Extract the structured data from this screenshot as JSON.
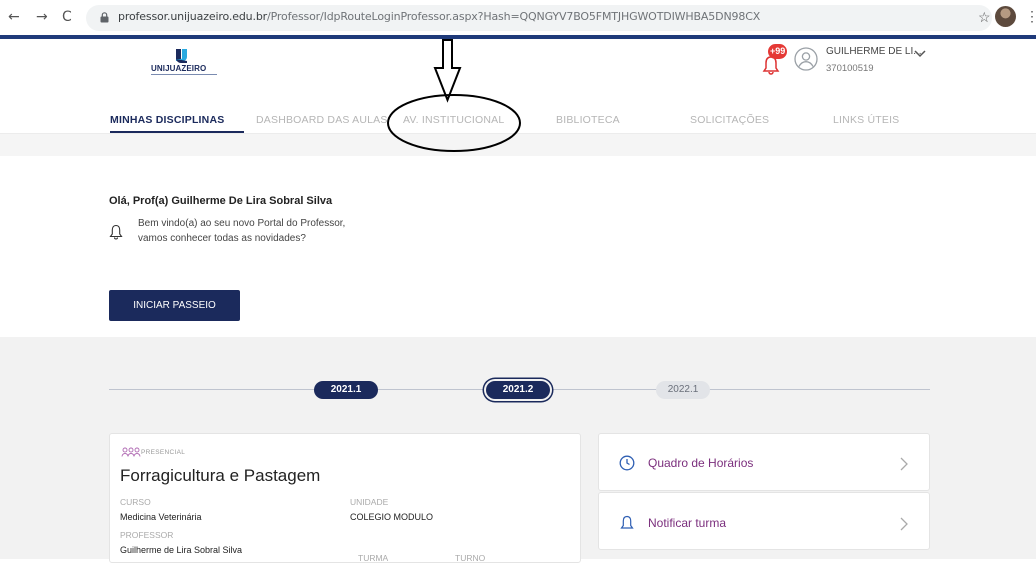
{
  "browser": {
    "back_glyph": "←",
    "forward_glyph": "→",
    "reload_glyph": "C",
    "url_host": "professor.unijuazeiro.edu.br",
    "url_path": "/Professor/IdpRouteLoginProfessor.aspx?Hash=QQNGYV7BO5FMTJHGWOTDIWHBA5DN98CX",
    "star_glyph": "☆",
    "menu_glyph": "⋮"
  },
  "header": {
    "logo_text": "UNIJUAZEIRO",
    "notification_count": "+99",
    "user_name": "GUILHERME DE LI...",
    "user_id": "370100519"
  },
  "tabs": [
    {
      "label": "MINHAS DISCIPLINAS",
      "active": true
    },
    {
      "label": "DASHBOARD DAS AULAS",
      "active": false
    },
    {
      "label": "AV. INSTITUCIONAL",
      "active": false
    },
    {
      "label": "BIBLIOTECA",
      "active": false
    },
    {
      "label": "SOLICITAÇÕES",
      "active": false
    },
    {
      "label": "LINKS ÚTEIS",
      "active": false
    }
  ],
  "welcome": {
    "greeting": "Olá, Prof(a) Guilherme De Lira Sobral Silva",
    "line1": "Bem vindo(a) ao seu novo Portal do Professor,",
    "line2": "vamos conhecer todas as novidades?",
    "tour_button": "INICIAR PASSEIO"
  },
  "periods": [
    {
      "label": "2021.1",
      "state": "done"
    },
    {
      "label": "2021.2",
      "state": "selected"
    },
    {
      "label": "2022.1",
      "state": "future"
    }
  ],
  "course": {
    "modality": "PRESENCIAL",
    "title": "Forragicultura e Pastagem",
    "curso_label": "CURSO",
    "curso": "Medicina Veterinária",
    "unidade_label": "UNIDADE",
    "unidade": "COLEGIO MODULO",
    "professor_label": "PROFESSOR",
    "professor": "Guilherme de Lira Sobral Silva",
    "turma_label": "TURMA",
    "turno_label": "TURNO"
  },
  "side_cards": [
    {
      "label": "Quadro de Horários",
      "icon": "clock-icon"
    },
    {
      "label": "Notificar turma",
      "icon": "bell-icon"
    }
  ],
  "colors": {
    "brand": "#1b2a5c",
    "accent_link": "#7b2f7d",
    "badge": "#e53935"
  }
}
